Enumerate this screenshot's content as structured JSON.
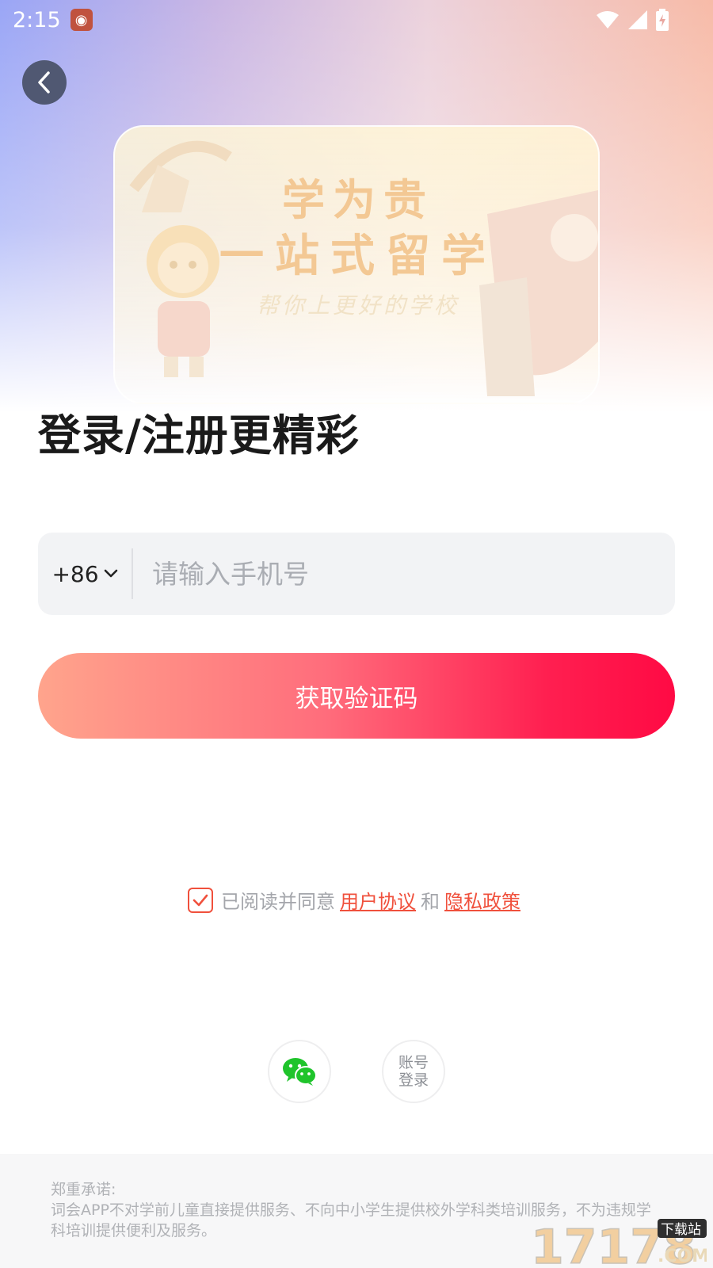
{
  "status_bar": {
    "time": "2:15",
    "icons": [
      "weibo-app-icon",
      "wifi-icon",
      "signal-icon",
      "battery-charging-icon"
    ]
  },
  "back": {
    "icon": "chevron-left-icon"
  },
  "banner": {
    "line1": "学为贵",
    "line2": "一站式留学",
    "line3": "帮你上更好的学校"
  },
  "page_title": "登录/注册更精彩",
  "phone": {
    "country_code": "+86",
    "placeholder": "请输入手机号",
    "value": ""
  },
  "get_code_button": "获取验证码",
  "agreement": {
    "checked": true,
    "prefix": "已阅读并同意",
    "user_agreement": "用户协议",
    "and": "和",
    "privacy_policy": "隐私政策"
  },
  "social": {
    "wechat_icon": "wechat-icon",
    "account_login_line1": "账号",
    "account_login_line2": "登录"
  },
  "footer": {
    "heading": "郑重承诺:",
    "text": "词会APP不对学前儿童直接提供服务、不向中小学生提供校外学科类培训服务，不为违规学科培训提供便利及服务。"
  },
  "watermark": {
    "text": "17178",
    "sub1": "下载站",
    "sub2": ".COM"
  },
  "colors": {
    "accent": "#f0503c",
    "button_start": "#ffa48c",
    "button_end": "#ff0a44",
    "input_bg": "#f2f3f5"
  }
}
